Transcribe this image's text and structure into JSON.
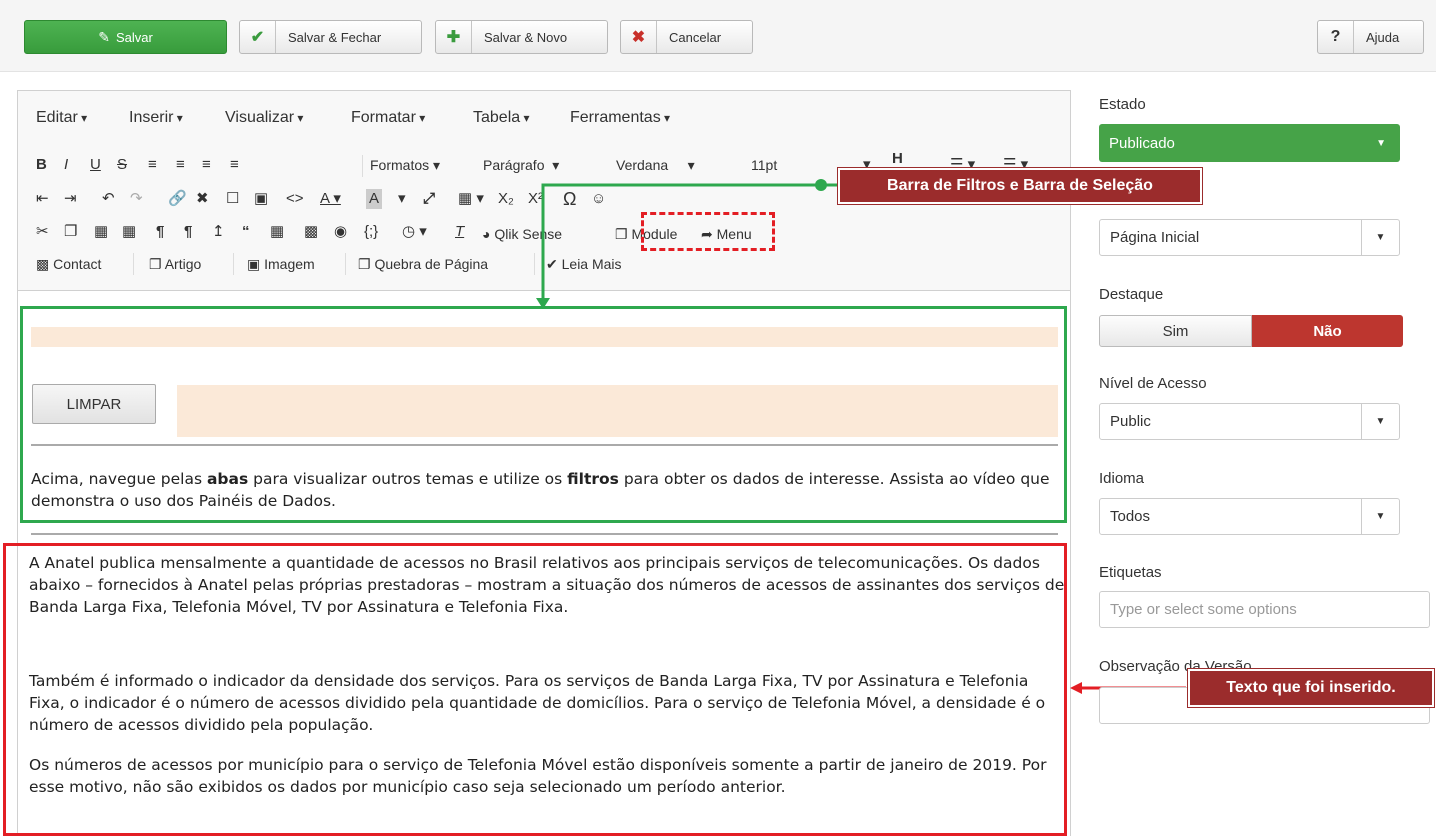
{
  "toolbar": {
    "save": "Salvar",
    "save_close": "Salvar & Fechar",
    "save_new": "Salvar & Novo",
    "cancel": "Cancelar",
    "help": "Ajuda"
  },
  "editor": {
    "menus": [
      "Editar",
      "Inserir",
      "Visualizar",
      "Formatar",
      "Tabela",
      "Ferramentas"
    ],
    "formats": "Formatos",
    "paragraph": "Parágrafo",
    "font": "Verdana",
    "size": "11pt",
    "buttons": {
      "qlik": "Qlik Sense",
      "module": "Module",
      "menu": "Menu",
      "contact": "Contact",
      "artigo": "Artigo",
      "imagem": "Imagem",
      "quebra": "Quebra de Página",
      "leia_mais": "Leia Mais"
    }
  },
  "content": {
    "limpar": "LIMPAR",
    "intro_pre": "Acima, navegue pelas ",
    "intro_b1": "abas",
    "intro_mid": " para visualizar outros temas e utilize os ",
    "intro_b2": "filtros",
    "intro_post": " para obter os dados de interesse. Assista ao vídeo que demonstra o uso dos Painéis de Dados.",
    "p1": "A Anatel publica mensalmente a quantidade de acessos no Brasil relativos aos principais serviços de telecomunicações. Os dados abaixo – fornecidos à Anatel pelas próprias prestadoras – mostram a situação dos números de acessos de assinantes dos serviços de Banda Larga Fixa, Telefonia Móvel, TV por Assinatura e Telefonia Fixa.",
    "p2": "Também é informado o indicador da densidade dos serviços. Para os serviços de Banda Larga Fixa, TV por Assinatura e Telefonia Fixa, o indicador é o número de acessos dividido pela quantidade de domicílios. Para o serviço de Telefonia Móvel, a densidade é o número de acessos dividido pela população.",
    "p3": "Os números de acessos por município para o serviço de Telefonia Móvel estão disponíveis somente a partir de janeiro de 2019. Por esse motivo, não são exibidos os dados por município caso seja selecionado um período anterior."
  },
  "annotations": {
    "filters": "Barra de Filtros e Barra de Seleção",
    "inserted": "Texto que foi inserido."
  },
  "sidebar": {
    "estado_label": "Estado",
    "estado_value": "Publicado",
    "pagina_value": "Página Inicial",
    "destaque_label": "Destaque",
    "sim": "Sim",
    "nao": "Não",
    "nivel_label": "Nível de Acesso",
    "nivel_value": "Public",
    "idioma_label": "Idioma",
    "idioma_value": "Todos",
    "etiquetas_label": "Etiquetas",
    "etiquetas_placeholder": "Type or select some options",
    "obs_label": "Observação da Versão"
  },
  "colors": {
    "success": "#46a348",
    "danger": "#bd362f",
    "annotation_green": "#2ea84e",
    "annotation_red": "#e31e24",
    "callout": "#9b2c2c"
  }
}
